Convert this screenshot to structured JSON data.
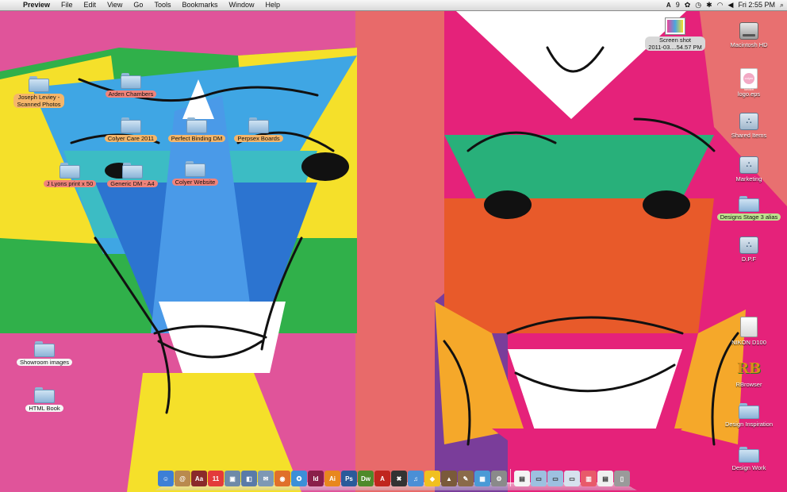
{
  "menubar": {
    "app": "Preview",
    "items": [
      "File",
      "Edit",
      "View",
      "Go",
      "Tools",
      "Bookmarks",
      "Window",
      "Help"
    ],
    "status_count": "9",
    "clock": "Fri 2:55 PM"
  },
  "desktop_left": [
    {
      "name": "Joseph Leviey - Scanned Photos",
      "label": "Joseph Leviey -\nScanned Photos"
    },
    {
      "name": "Arden Chambers",
      "label": "Arden Chambers"
    },
    {
      "name": "Colyer Care 2011",
      "label": "Colyer Care 2011"
    },
    {
      "name": "Perfect Binding DM",
      "label": "Perfect Binding DM"
    },
    {
      "name": "Perpsex Boards",
      "label": "Perpsex Boards"
    },
    {
      "name": "J Lyons print x 50",
      "label": "J Lyons print x 50"
    },
    {
      "name": "Generic DM - A4",
      "label": "Generic DM - A4"
    },
    {
      "name": "Colyer Website",
      "label": "Colyer Website"
    },
    {
      "name": "Showroom images",
      "label": "Showroom images"
    },
    {
      "name": "HTML Book",
      "label": "HTML Book"
    }
  ],
  "desktop_right": [
    {
      "label": "Screen shot\n2011-03....54.57 PM"
    },
    {
      "label": "Macintosh HD"
    },
    {
      "label": "logo.eps"
    },
    {
      "label": "Shared Items"
    },
    {
      "label": "Marketing"
    },
    {
      "label": "Designs Stage 3 alias"
    },
    {
      "label": "D.P.F"
    },
    {
      "label": "NIKON D100"
    },
    {
      "label": "RBrowser"
    },
    {
      "label": "Design Inspiration"
    },
    {
      "label": "Design Work"
    }
  ],
  "eps_thumb_text": "colyer london",
  "dock_apps": [
    {
      "icon": "finder-icon",
      "glyph": "☺",
      "color": "#3d7fd6"
    },
    {
      "icon": "address-book-icon",
      "glyph": "@",
      "color": "#b98a4e"
    },
    {
      "icon": "dictionary-icon",
      "glyph": "Aa",
      "color": "#8a2a2a"
    },
    {
      "icon": "ical-icon",
      "glyph": "11",
      "color": "#e33b3b"
    },
    {
      "icon": "preview-icon",
      "glyph": "▣",
      "color": "#6f8aa8"
    },
    {
      "icon": "photo-icon",
      "glyph": "◧",
      "color": "#5a7aa8"
    },
    {
      "icon": "mail-icon",
      "glyph": "✉",
      "color": "#7e98b4"
    },
    {
      "icon": "firefox-icon",
      "glyph": "◉",
      "color": "#e0702a"
    },
    {
      "icon": "safari-icon",
      "glyph": "✪",
      "color": "#3c8fd8"
    },
    {
      "icon": "indesign-icon",
      "glyph": "Id",
      "color": "#8a1f4a"
    },
    {
      "icon": "illustrator-icon",
      "glyph": "Ai",
      "color": "#e8871e"
    },
    {
      "icon": "photoshop-icon",
      "glyph": "Ps",
      "color": "#2a5a9a"
    },
    {
      "icon": "dreamweaver-icon",
      "glyph": "Dw",
      "color": "#4e8a2a"
    },
    {
      "icon": "acrobat-icon",
      "glyph": "A",
      "color": "#c0261e"
    },
    {
      "icon": "xmarks-icon",
      "glyph": "✖",
      "color": "#333333"
    },
    {
      "icon": "itunes-icon",
      "glyph": "♫",
      "color": "#4a8fd6"
    },
    {
      "icon": "cyberduck-icon",
      "glyph": "◆",
      "color": "#f0c020"
    },
    {
      "icon": "keynote-icon",
      "glyph": "▲",
      "color": "#7a5a3a"
    },
    {
      "icon": "brush-icon",
      "glyph": "✎",
      "color": "#8a6a4a"
    },
    {
      "icon": "preview2-icon",
      "glyph": "▦",
      "color": "#4a9ad6"
    },
    {
      "icon": "system-prefs-icon",
      "glyph": "⚙",
      "color": "#8a8a8a"
    }
  ],
  "dock_docs": [
    {
      "icon": "document-icon",
      "glyph": "▤",
      "color": "#f4f4f4"
    },
    {
      "icon": "folder-stack-icon",
      "glyph": "▭",
      "color": "#9dc0e0"
    },
    {
      "icon": "folder-stack-icon",
      "glyph": "▭",
      "color": "#9dc0e0"
    },
    {
      "icon": "downloads-icon",
      "glyph": "▭",
      "color": "#d6e2ee"
    },
    {
      "icon": "pictures-stack-icon",
      "glyph": "▥",
      "color": "#e85a6a"
    },
    {
      "icon": "docs-stack-icon",
      "glyph": "▤",
      "color": "#f0f0f0"
    },
    {
      "icon": "trash-icon",
      "glyph": "▯",
      "color": "#9a9a9a"
    }
  ]
}
